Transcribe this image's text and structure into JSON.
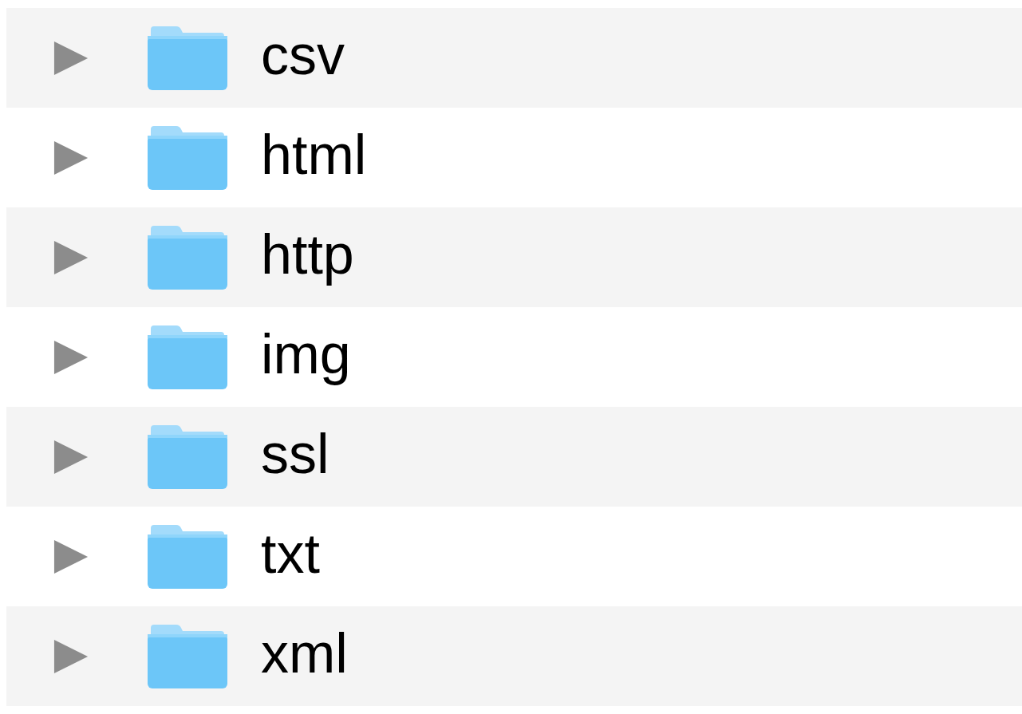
{
  "folders": [
    {
      "name": "csv",
      "expanded": false
    },
    {
      "name": "html",
      "expanded": false
    },
    {
      "name": "http",
      "expanded": false
    },
    {
      "name": "img",
      "expanded": false
    },
    {
      "name": "ssl",
      "expanded": false
    },
    {
      "name": "txt",
      "expanded": false
    },
    {
      "name": "xml",
      "expanded": false
    }
  ]
}
